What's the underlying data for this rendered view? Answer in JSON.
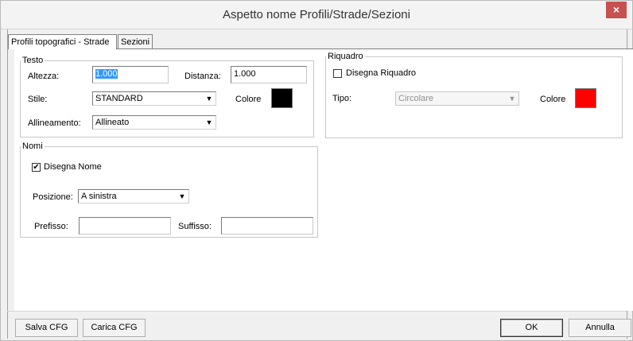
{
  "window": {
    "title": "Aspetto nome Profili/Strade/Sezioni",
    "close_glyph": "×"
  },
  "tabs": [
    {
      "label": "Profili topografici - Strade",
      "active": true
    },
    {
      "label": "Sezioni",
      "active": false
    }
  ],
  "testo": {
    "legend": "Testo",
    "altezza_label": "Altezza:",
    "altezza_value": "1.000",
    "distanza_label": "Distanza:",
    "distanza_value": "1.000",
    "stile_label": "Stile:",
    "stile_value": "STANDARD",
    "colore_label": "Colore",
    "colore_color": "#000000",
    "allineamento_label": "Allineamento:",
    "allineamento_value": "Allineato"
  },
  "nomi": {
    "legend": "Nomi",
    "disegna_label": "Disegna Nome",
    "disegna_checked": true,
    "posizione_label": "Posizione:",
    "posizione_value": "A sinistra",
    "prefisso_label": "Prefisso:",
    "prefisso_value": "",
    "suffisso_label": "Suffisso:",
    "suffisso_value": ""
  },
  "riquadro": {
    "legend": "Riquadro",
    "disegna_label": "Disegna Riquadro",
    "disegna_checked": false,
    "tipo_label": "Tipo:",
    "tipo_value": "Circolare",
    "colore_label": "Colore",
    "colore_color": "#ff0000"
  },
  "footer": {
    "salva_label": "Salva CFG",
    "carica_label": "Carica CFG",
    "ok_label": "OK",
    "annulla_label": "Annulla"
  },
  "glyphs": {
    "dropdown_arrow": "▼",
    "check": "✔"
  }
}
